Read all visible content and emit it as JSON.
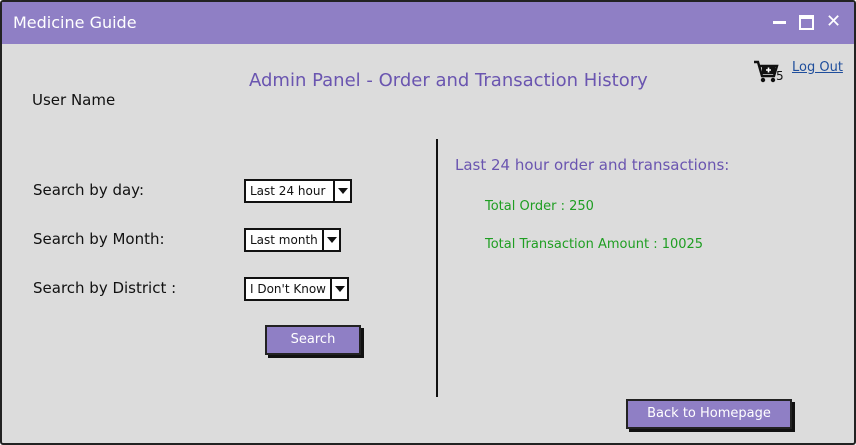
{
  "window": {
    "title": "Medicine Guide"
  },
  "header": {
    "heading": "Admin Panel - Order and Transaction History",
    "cart_count": "5",
    "logout_label": "Log Out"
  },
  "user": {
    "name": "User Name"
  },
  "filters": {
    "day": {
      "label": "Search by day:",
      "value": "Last 24 hour"
    },
    "month": {
      "label": "Search by Month:",
      "value": "Last month"
    },
    "district": {
      "label": "Search by District :",
      "value": "I Don't Know"
    },
    "search_label": "Search"
  },
  "summary": {
    "title": "Last 24 hour order and transactions:",
    "total_order": "Total Order : 250",
    "total_amount": "Total Transaction Amount : 10025"
  },
  "footer": {
    "back_label": "Back to Homepage"
  },
  "colors": {
    "accent": "#8f7fc5",
    "heading": "#6a55b0",
    "stat": "#1f9e22",
    "link": "#1f4e9c"
  }
}
